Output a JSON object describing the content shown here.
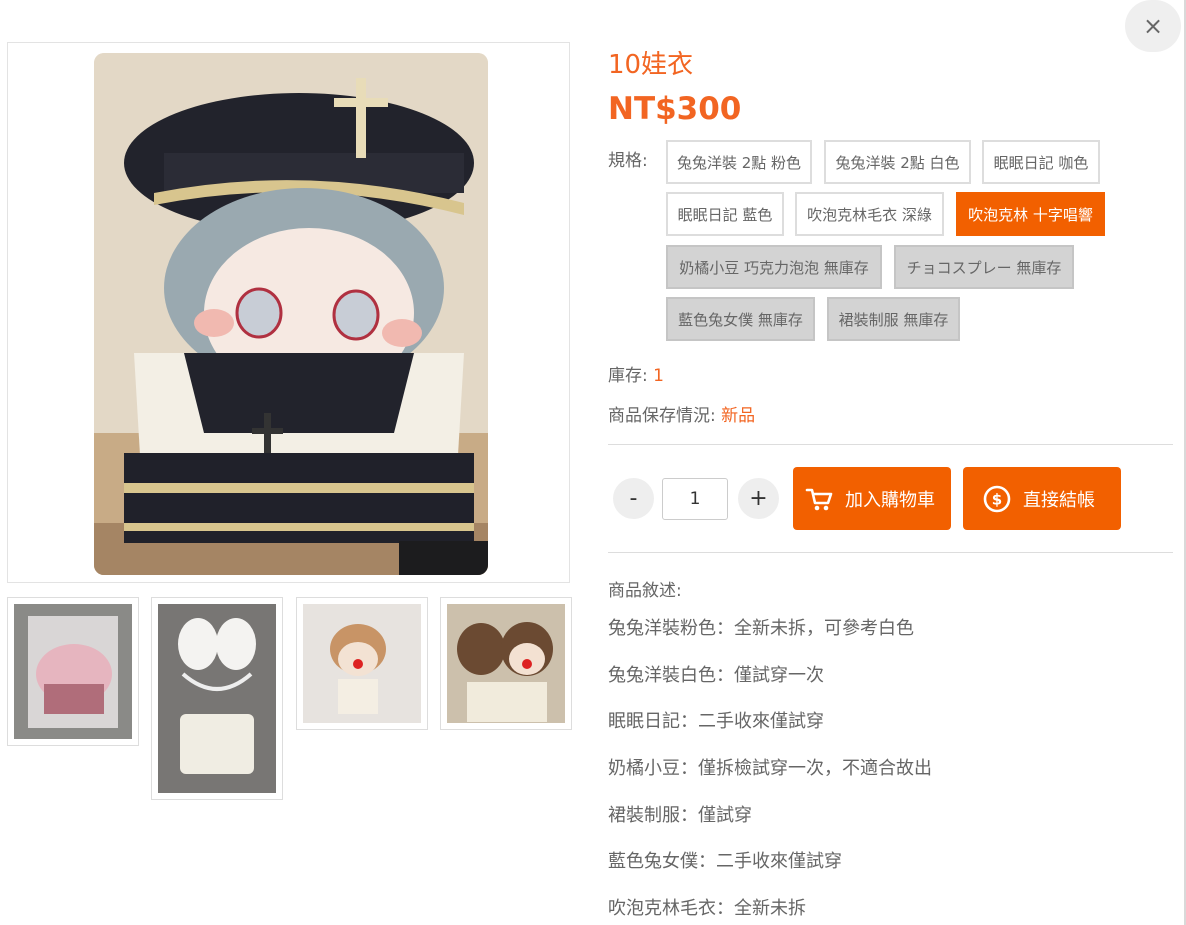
{
  "product": {
    "title": "10娃衣",
    "price": "NT$300"
  },
  "spec": {
    "label": "規格:",
    "options": [
      {
        "label": "兔兔洋裝 2點 粉色",
        "state": "normal"
      },
      {
        "label": "兔兔洋裝 2點 白色",
        "state": "normal"
      },
      {
        "label": "眠眠日記 咖色",
        "state": "normal"
      },
      {
        "label": "眠眠日記 藍色",
        "state": "normal"
      },
      {
        "label": "吹泡克林毛衣 深綠",
        "state": "normal"
      },
      {
        "label": "吹泡克林 十字唱響",
        "state": "active"
      },
      {
        "label": "奶橘小豆 巧克力泡泡 無庫存",
        "state": "disabled"
      },
      {
        "label": "チョコスプレー 無庫存",
        "state": "disabled"
      },
      {
        "label": "藍色兔女僕 無庫存",
        "state": "disabled"
      },
      {
        "label": "裙裝制服 無庫存",
        "state": "disabled"
      }
    ]
  },
  "stock": {
    "label": "庫存: ",
    "value": "1"
  },
  "condition": {
    "label": "商品保存情況: ",
    "value": "新品"
  },
  "quantity": {
    "minus": "-",
    "plus": "+",
    "value": "1"
  },
  "actions": {
    "add_to_cart": "加入購物車",
    "checkout": "直接結帳"
  },
  "description": {
    "label": "商品敘述:",
    "lines": [
      "兔兔洋裝粉色：全新未拆，可參考白色",
      "兔兔洋裝白色：僅試穿一次",
      "眠眠日記：二手收來僅試穿",
      "奶橘小豆：僅拆檢試穿一次，不適合故出",
      "裙裝制服：僅試穿",
      "藍色兔女僕：二手收來僅試穿",
      "吹泡克林毛衣：全新未拆"
    ]
  },
  "close": {
    "label": "×"
  },
  "colors": {
    "accent": "#f26000",
    "price": "#f26522",
    "disabled_bg": "#d3d3d3"
  },
  "icons": {
    "close": "close-icon",
    "cart": "cart-icon",
    "checkout": "dollar-coin-icon"
  }
}
